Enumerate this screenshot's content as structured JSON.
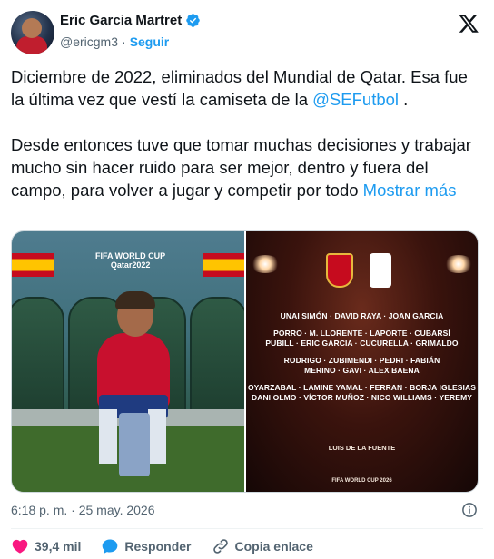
{
  "author": {
    "display_name": "Eric Garcia Martret",
    "handle": "@ericgm3",
    "follow_label": "Seguir",
    "verified": true
  },
  "tweet": {
    "paragraph1_text": "Diciembre de 2022, eliminados del Mundial de Qatar. Esa fue la última vez que vestí la camiseta de la ",
    "paragraph1_mention": "@SEFutbol",
    "paragraph1_end": " .",
    "paragraph2_text": "Desde entonces tuve que tomar muchas decisiones y trabajar mucho sin hacer ruido para ser mejor, dentro y fuera del campo, para volver a jugar y competir por todo ",
    "show_more": "Mostrar más"
  },
  "media": {
    "left_image": {
      "wc_label_line1": "FIFA WORLD CUP",
      "wc_label_line2": "Qatar2022"
    },
    "right_image": {
      "roster_groups": [
        [
          "UNAI SIMÓN · DAVID RAYA · JOAN GARCIA"
        ],
        [
          "PORRO · M. LLORENTE · LAPORTE · CUBARSÍ",
          "PUBILL · ERIC GARCIA · CUCURELLA · GRIMALDO"
        ],
        [
          "RODRIGO · ZUBIMENDI · PEDRI · FABIÁN",
          "MERINO · GAVI · ALEX BAENA"
        ],
        [
          "OYARZABAL · LAMINE YAMAL · FERRAN · BORJA IGLESIAS",
          "DANI OLMO · VÍCTOR MUÑOZ · NICO WILLIAMS · YEREMY"
        ]
      ],
      "coach": "LUIS DE LA FUENTE",
      "footer": "FIFA WORLD CUP 2026"
    }
  },
  "meta": {
    "timestamp": "6:18 p. m. · 25 may. 2026"
  },
  "actions": {
    "likes": "39,4 mil",
    "reply_label": "Responder",
    "copy_link_label": "Copia enlace"
  },
  "colors": {
    "link": "#1d9bf0",
    "like": "#f91880",
    "text": "#0f1419",
    "muted": "#536471"
  }
}
